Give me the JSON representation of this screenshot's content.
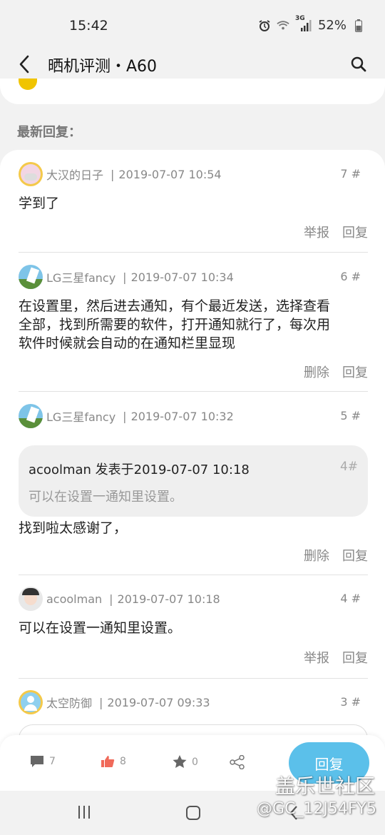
{
  "status_bar": {
    "time": "15:42",
    "battery": "52%",
    "network": "3G"
  },
  "header": {
    "title": "晒机评测・A60"
  },
  "section_label": "最新回复：",
  "posts": [
    {
      "author": "大汉的日子",
      "time": "2019-07-07 10:54",
      "floor": "7 #",
      "content": "学到了",
      "action1": "举报",
      "action2": "回复"
    },
    {
      "author": "LG三星fancy",
      "time": "2019-07-07 10:34",
      "floor": "6 #",
      "content_lines": [
        "在设置里，然后进去通知，有个最近发送，选择查看",
        "全部，找到所需要的软件，打开通知就行了，每次用",
        "软件时候就会自动的在通知栏里显现"
      ],
      "action1": "删除",
      "action2": "回复"
    },
    {
      "author": "LG三星fancy",
      "time": "2019-07-07 10:32",
      "floor": "5 #",
      "quote": {
        "author": "acoolman 发表于2019-07-07 10:18",
        "floor": "4#",
        "text": "可以在设置一通知里设置。"
      },
      "content": "找到啦太感谢了，",
      "action1": "删除",
      "action2": "回复"
    },
    {
      "author": "acoolman",
      "time": "2019-07-07 10:18",
      "floor": "4 #",
      "content": "可以在设置一通知里设置。",
      "action1": "举报",
      "action2": "回复"
    },
    {
      "author": "太空防御",
      "time": "2019-07-07 09:33",
      "floor": "3 #"
    }
  ],
  "bottom_bar": {
    "comments": "7",
    "likes": "8",
    "favorites": "0",
    "reply_label": "回复"
  },
  "watermark": {
    "line1": "盖乐世社区",
    "line2": "@GC_12J54FY5"
  },
  "colors": {
    "accent": "#5bc0ea",
    "like": "#f06a5a",
    "text_secondary": "#888888"
  },
  "icons": [
    "back-arrow-icon",
    "search-icon",
    "comment-icon",
    "thumbs-up-icon",
    "star-icon",
    "share-icon",
    "alarm-icon",
    "wifi-icon",
    "battery-icon"
  ]
}
